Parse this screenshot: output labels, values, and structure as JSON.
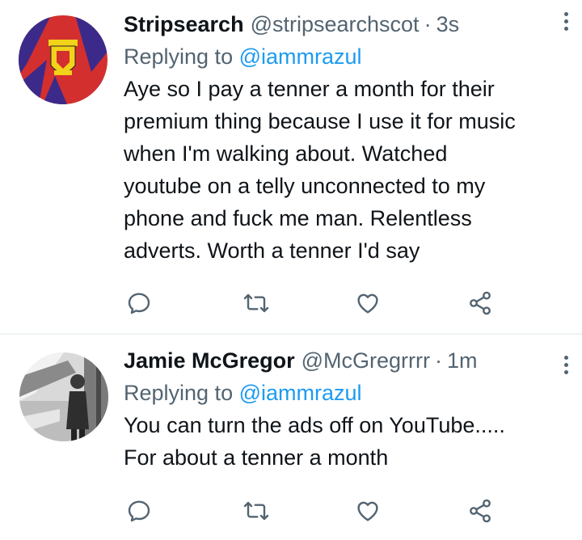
{
  "tweets": [
    {
      "name": "Stripsearch",
      "handle": "@stripsearchscot",
      "separator": "·",
      "time": "3s",
      "replying_prefix": "Replying to",
      "replying_to": "@iammrazul",
      "text_lines": [
        "Aye so I pay a tenner a month for their",
        "premium thing because I use it for music",
        "when I'm walking about. Watched",
        "youtube on a telly unconnected to my",
        "phone and fuck me man. Relentless",
        "adverts. Worth a tenner I'd say"
      ]
    },
    {
      "name": "Jamie McGregor",
      "handle": "@McGregrrrr",
      "separator": "·",
      "time": "1m",
      "replying_prefix": "Replying to",
      "replying_to": "@iammrazul",
      "text_lines": [
        "You can turn the ads off on YouTube.....",
        "For about a tenner a month"
      ]
    }
  ],
  "icons": {
    "reply": "reply-icon",
    "retweet": "retweet-icon",
    "like": "heart-icon",
    "share": "share-icon",
    "more": "more-vertical-icon"
  },
  "colors": {
    "text": "#0f1419",
    "secondary": "#536471",
    "link": "#1d9bf0",
    "divider": "#eff3f4",
    "avatar1_red": "#d32f2f",
    "avatar1_purple": "#3b2a8a",
    "avatar1_yellow": "#f3d21a"
  }
}
